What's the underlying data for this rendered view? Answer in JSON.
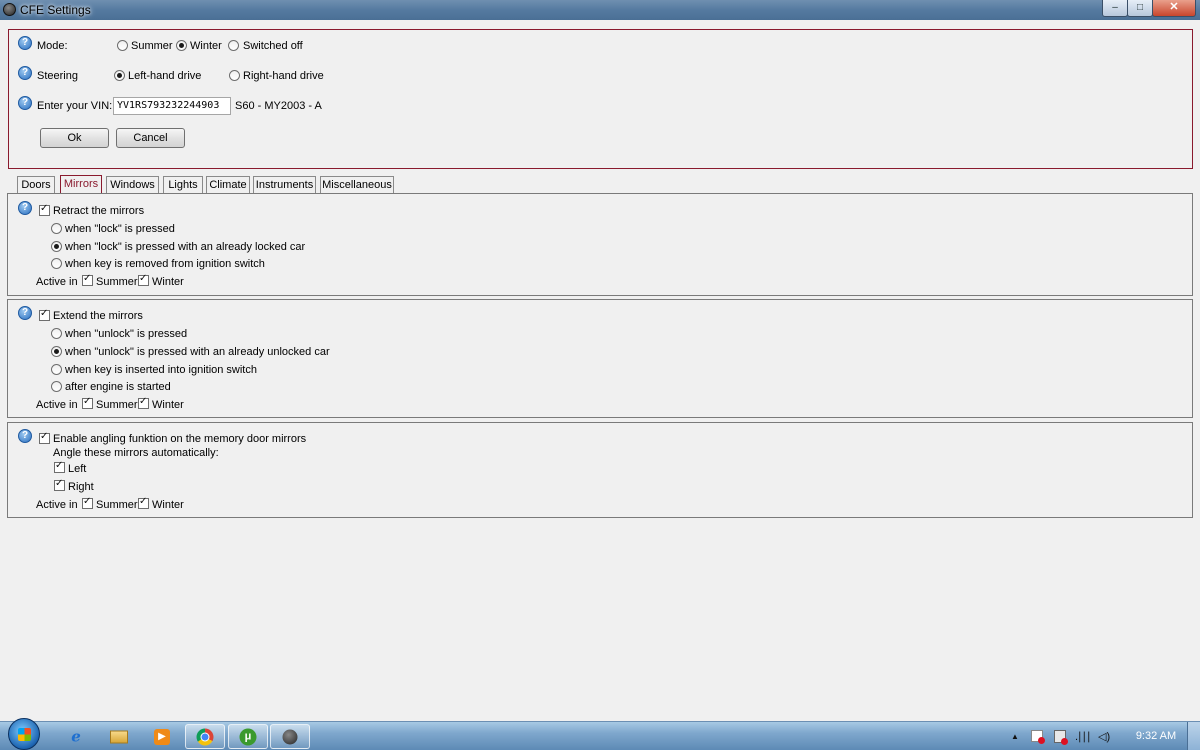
{
  "window": {
    "title": "CFE Settings",
    "minimize": "–",
    "maximize": "□",
    "close": "✕"
  },
  "settings": {
    "help_glyph": "?",
    "mode_label": "Mode:",
    "mode_options": [
      "Summer",
      "Winter",
      "Switched off"
    ],
    "mode_selected": "Winter",
    "steering_label": "Steering",
    "steering_options": [
      "Left-hand drive",
      "Right-hand drive"
    ],
    "steering_selected": "Left-hand drive",
    "vin_label": "Enter your VIN:",
    "vin_value": "YV1RS793232244903",
    "vin_model": "S60 - MY2003 - A",
    "ok_label": "Ok",
    "cancel_label": "Cancel"
  },
  "tabs": [
    "Doors",
    "Mirrors",
    "Windows",
    "Lights",
    "Climate",
    "Instruments",
    "Miscellaneous"
  ],
  "active_tab": "Mirrors",
  "retract": {
    "title": "Retract the mirrors",
    "checked": true,
    "options": [
      "when \"lock\" is pressed",
      "when \"lock\" is pressed with an already locked car",
      "when key is removed from ignition switch"
    ],
    "selected": 1,
    "active_in_label": "Active in",
    "summer_label": "Summer",
    "winter_label": "Winter"
  },
  "extend": {
    "title": "Extend the mirrors",
    "checked": true,
    "options": [
      "when \"unlock\" is pressed",
      "when \"unlock\" is pressed with an already unlocked car",
      "when key is inserted into ignition switch",
      "after engine is started"
    ],
    "selected": 1,
    "active_in_label": "Active in",
    "summer_label": "Summer",
    "winter_label": "Winter"
  },
  "angling": {
    "title": "Enable angling funktion on the memory door mirrors",
    "checked": true,
    "subtitle": "Angle these mirrors automatically:",
    "left_label": "Left",
    "right_label": "Right",
    "active_in_label": "Active in",
    "summer_label": "Summer",
    "winter_label": "Winter"
  },
  "taskbar": {
    "icons": [
      "windows-start-icon",
      "internet-explorer-icon",
      "file-explorer-icon",
      "media-player-icon",
      "chrome-icon",
      "utorrent-icon",
      "cfe-app-icon"
    ],
    "tray_arrow": "▲",
    "tray_signal": ".∣∣∣",
    "tray_volume": "◁)",
    "clock": "9:32 AM"
  }
}
